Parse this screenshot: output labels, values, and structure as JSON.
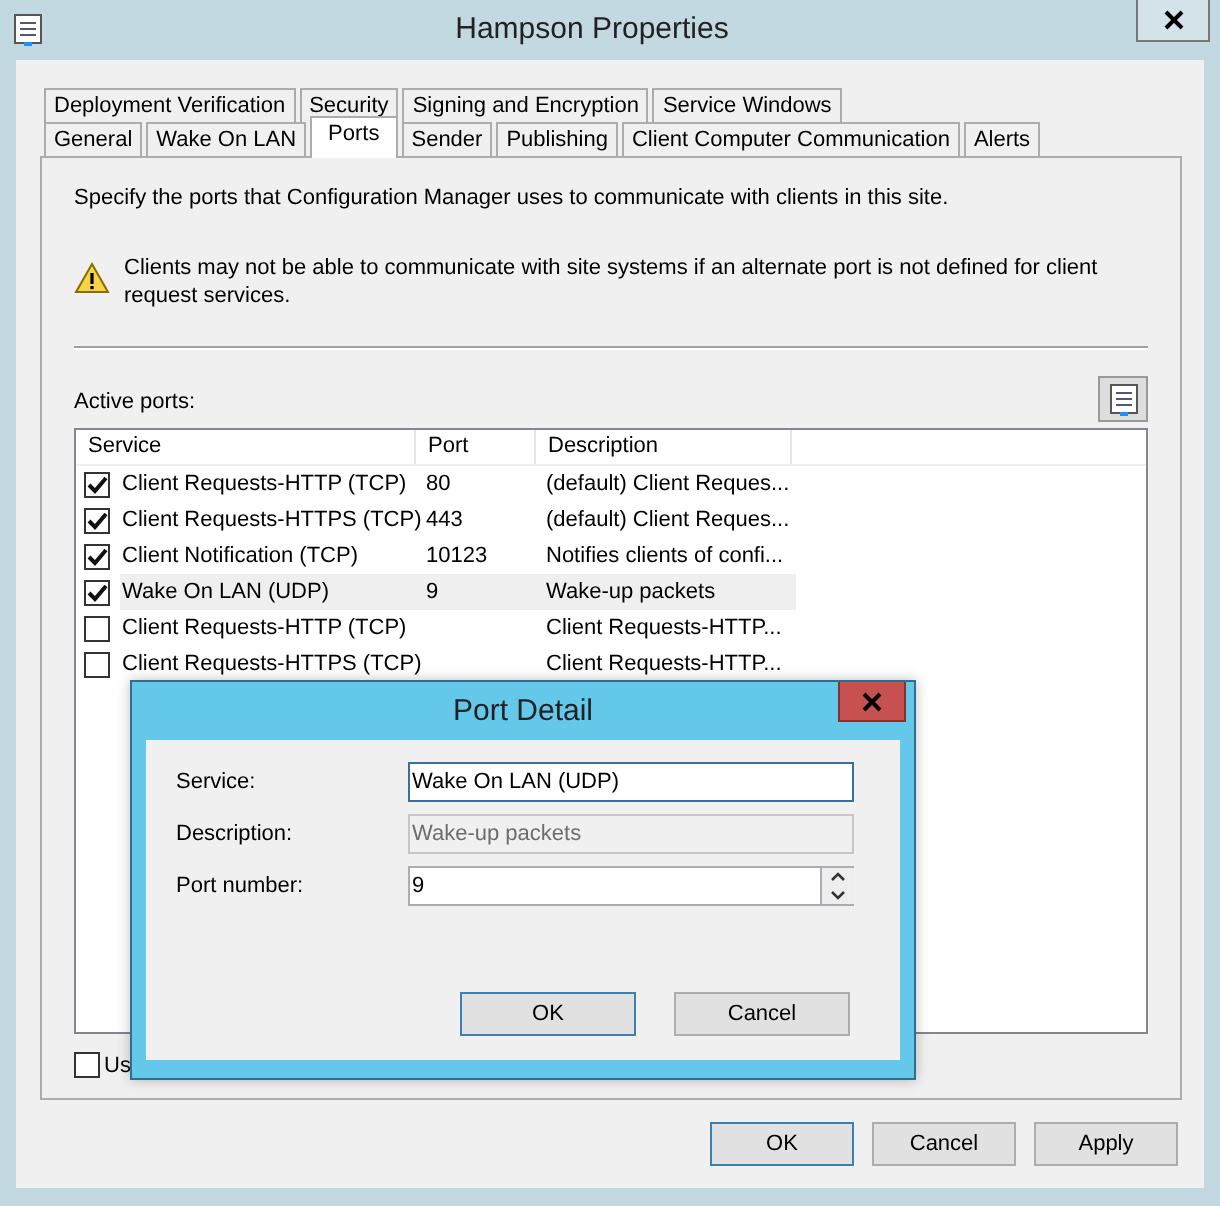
{
  "window": {
    "title": "Hampson Properties"
  },
  "tab_rows": [
    [
      {
        "label": "Deployment Verification",
        "selected": false
      },
      {
        "label": "Security",
        "selected": false
      },
      {
        "label": "Signing and Encryption",
        "selected": false
      },
      {
        "label": "Service Windows",
        "selected": false
      }
    ],
    [
      {
        "label": "General",
        "selected": false
      },
      {
        "label": "Wake On LAN",
        "selected": false
      },
      {
        "label": "Ports",
        "selected": true
      },
      {
        "label": "Sender",
        "selected": false
      },
      {
        "label": "Publishing",
        "selected": false
      },
      {
        "label": "Client Computer Communication",
        "selected": false
      },
      {
        "label": "Alerts",
        "selected": false
      }
    ]
  ],
  "intro": "Specify the ports that Configuration Manager uses to communicate with clients in this site.",
  "warning": "Clients may not be able to communicate with site systems if an alternate port is not defined for client request services.",
  "active_ports": {
    "label": "Active ports:",
    "columns": [
      "Service",
      "Port",
      "Description"
    ],
    "rows": [
      {
        "checked": true,
        "selected": false,
        "service": "Client Requests-HTTP (TCP)",
        "port": "80",
        "description": "(default) Client Reques..."
      },
      {
        "checked": true,
        "selected": false,
        "service": "Client Requests-HTTPS (TCP)",
        "port": "443",
        "description": "(default) Client Reques..."
      },
      {
        "checked": true,
        "selected": false,
        "service": "Client Notification (TCP)",
        "port": "10123",
        "description": "Notifies clients of confi..."
      },
      {
        "checked": true,
        "selected": true,
        "service": "Wake On LAN (UDP)",
        "port": "9",
        "description": "Wake-up packets"
      },
      {
        "checked": false,
        "selected": false,
        "service": "Client Requests-HTTP (TCP)",
        "description": "Client Requests-HTTP..."
      },
      {
        "checked": false,
        "selected": false,
        "service": "Client Requests-HTTPS (TCP)",
        "description": "Client Requests-HTTP..."
      }
    ]
  },
  "option": {
    "label": "Us",
    "checked": false
  },
  "buttons": [
    {
      "label": "OK",
      "default": true
    },
    {
      "label": "Cancel",
      "default": false
    },
    {
      "label": "Apply",
      "default": false
    }
  ],
  "dialog": {
    "title": "Port Detail",
    "fields": [
      {
        "kind": "text",
        "label": "Service:",
        "value": "Wake On LAN (UDP)",
        "disabled": false,
        "focused": true
      },
      {
        "kind": "text",
        "label": "Description:",
        "value": "Wake-up packets",
        "disabled": true,
        "focused": false
      },
      {
        "kind": "spin",
        "label": "Port number:",
        "value": "9",
        "disabled": false,
        "focused": false
      }
    ],
    "buttons": [
      {
        "label": "OK",
        "default": true
      },
      {
        "label": "Cancel",
        "default": false
      }
    ]
  }
}
